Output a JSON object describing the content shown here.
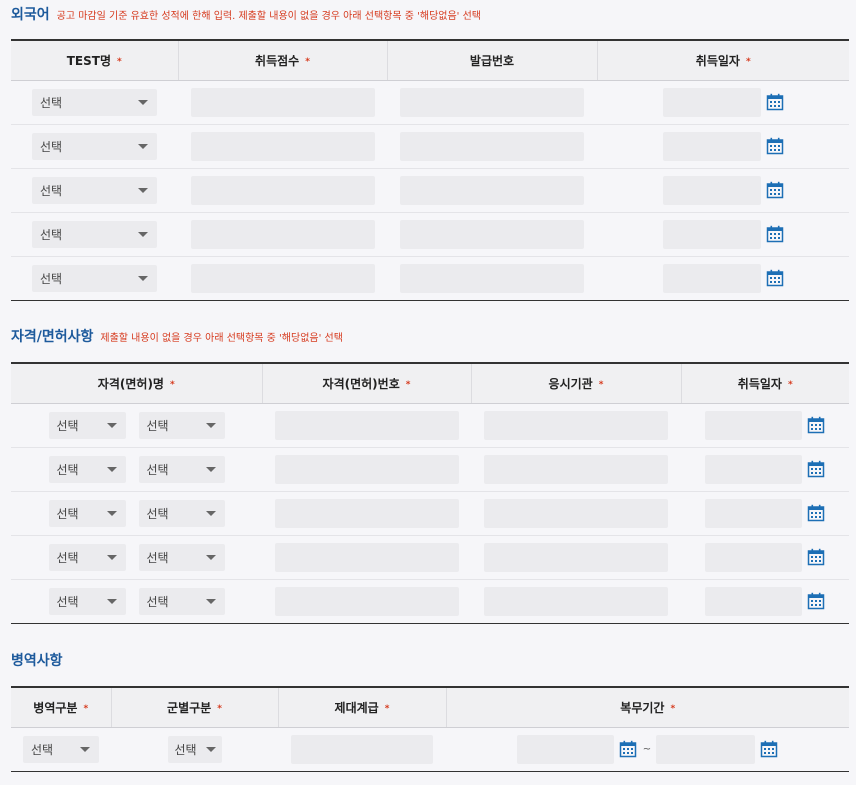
{
  "foreign": {
    "title": "외국어",
    "note": "공고 마감일 기준 유효한 성적에 한해 입력. 제출할 내용이 없을 경우 아래 선택항목 중 '해당없음' 선택",
    "headers": [
      "TEST명",
      "취득점수",
      "발급번호",
      "취득일자"
    ],
    "required_mark": "*",
    "rows": [
      {
        "test": "선택",
        "score": "",
        "issue_no": "",
        "date": ""
      },
      {
        "test": "선택",
        "score": "",
        "issue_no": "",
        "date": ""
      },
      {
        "test": "선택",
        "score": "",
        "issue_no": "",
        "date": ""
      },
      {
        "test": "선택",
        "score": "",
        "issue_no": "",
        "date": ""
      },
      {
        "test": "선택",
        "score": "",
        "issue_no": "",
        "date": ""
      }
    ]
  },
  "license": {
    "title": "자격/면허사항",
    "note": "제출할 내용이 없을 경우 아래 선택항목 중 '해당없음' 선택",
    "headers": [
      "자격(면허)명",
      "자격(면허)번호",
      "응시기관",
      "취득일자"
    ],
    "rows": [
      {
        "cat1": "선택",
        "cat2": "선택"
      },
      {
        "cat1": "선택",
        "cat2": "선택"
      },
      {
        "cat1": "선택",
        "cat2": "선택"
      },
      {
        "cat1": "선택",
        "cat2": "선택"
      },
      {
        "cat1": "선택",
        "cat2": "선택"
      }
    ]
  },
  "military": {
    "title": "병역사항",
    "headers": [
      "병역구분",
      "군별구분",
      "제대계급",
      "복무기간"
    ],
    "row": {
      "service_type": "선택",
      "branch": "선택",
      "separator": "~"
    }
  },
  "icons": {
    "calendar": "calendar-icon",
    "dropdown": "chevron-down-icon"
  },
  "colors": {
    "title": "#1d5a9c",
    "note": "#d63a1e",
    "required": "#d63a1e",
    "calendar": "#1d6fb5"
  }
}
